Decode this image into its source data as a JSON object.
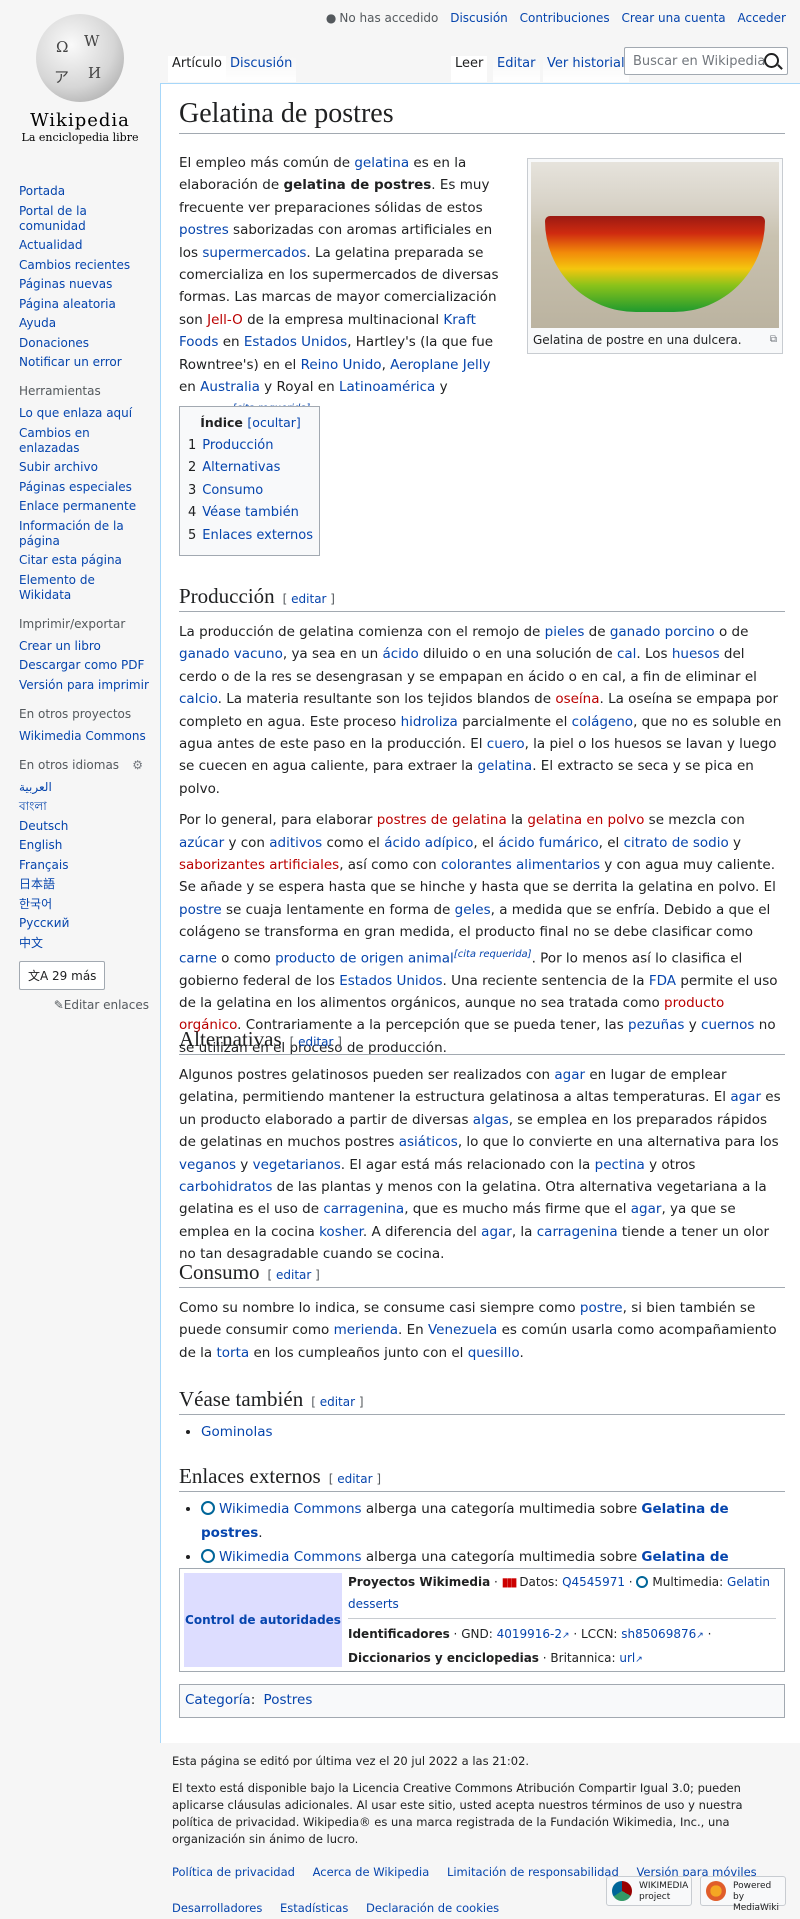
{
  "logo": {
    "wordmark": "Wikipedia",
    "tagline": "La enciclopedia libre"
  },
  "nav": [
    "Portada",
    "Portal de la comunidad",
    "Actualidad",
    "Cambios recientes",
    "Páginas nuevas",
    "Página aleatoria",
    "Ayuda",
    "Donaciones",
    "Notificar un error"
  ],
  "tools": {
    "heading": "Herramientas",
    "items": [
      "Lo que enlaza aquí",
      "Cambios en enlazadas",
      "Subir archivo",
      "Páginas especiales",
      "Enlace permanente",
      "Información de la página",
      "Citar esta página",
      "Elemento de Wikidata"
    ]
  },
  "print": {
    "heading": "Imprimir/exportar",
    "items": [
      "Crear un libro",
      "Descargar como PDF",
      "Versión para imprimir"
    ]
  },
  "projects": {
    "heading": "En otros proyectos",
    "items": [
      "Wikimedia Commons"
    ]
  },
  "langs": {
    "heading": "En otros idiomas",
    "items": [
      "العربية",
      "বাংলা",
      "Deutsch",
      "English",
      "Français",
      "日本語",
      "한국어",
      "Русский",
      "中文"
    ],
    "more": "29 más",
    "edit": "Editar enlaces"
  },
  "personal": {
    "not_logged": "No has accedido",
    "talk": "Discusión",
    "contribs": "Contribuciones",
    "create": "Crear una cuenta",
    "login": "Acceder"
  },
  "tabs": {
    "article": "Artículo",
    "talk": "Discusión",
    "read": "Leer",
    "edit": "Editar",
    "history": "Ver historial"
  },
  "search": {
    "placeholder": "Buscar en Wikipedia"
  },
  "title": "Gelatina de postres",
  "thumb_caption": "Gelatina de postre en una dulcera.",
  "toc": {
    "title": "Índice",
    "toggle": "[ocultar]",
    "items": [
      [
        "1",
        "Producción"
      ],
      [
        "2",
        "Alternativas"
      ],
      [
        "3",
        "Consumo"
      ],
      [
        "4",
        "Véase también"
      ],
      [
        "5",
        "Enlaces externos"
      ]
    ]
  },
  "sections": {
    "prod": "Producción",
    "alt": "Alternativas",
    "cons": "Consumo",
    "see": "Véase también",
    "ext": "Enlaces externos",
    "edit": "editar"
  },
  "see_also": [
    "Gominolas"
  ],
  "ext_links": [
    {
      "a": "Wikimedia Commons",
      "b": " alberga una categoría multimedia sobre ",
      "c": "Gelatina de postres",
      "d": "."
    },
    {
      "a": "Wikimedia Commons",
      "b": " alberga una categoría multimedia sobre ",
      "c": "Gelatina de postres",
      "d": "."
    }
  ],
  "authority": {
    "label": "Control de autoridades",
    "projects": "Proyectos Wikimedia",
    "data_label": "Datos:",
    "data_value": "Q4545971",
    "media_label": "Multimedia:",
    "media_value": "Gelatin desserts",
    "ids": "Identificadores",
    "gnd_label": "GND:",
    "gnd": "4019916-2",
    "lccn_label": "LCCN:",
    "lccn": "sh85069876",
    "dict": "Diccionarios y enciclopedias",
    "brit_label": "Britannica:",
    "brit": "url"
  },
  "category": {
    "label": "Categoría",
    "value": "Postres"
  },
  "footer": {
    "edited": "Esta página se editó por última vez el 20 jul 2022 a las 21:02.",
    "license": "El texto está disponible bajo la Licencia Creative Commons Atribución Compartir Igual 3.0; pueden aplicarse cláusulas adicionales. Al usar este sitio, usted acepta nuestros términos de uso y nuestra política de privacidad. Wikipedia® es una marca registrada de la Fundación Wikimedia, Inc., una organización sin ánimo de lucro.",
    "links1": [
      "Política de privacidad",
      "Acerca de Wikipedia",
      "Limitación de responsabilidad",
      "Versión para móviles"
    ],
    "links2": [
      "Desarrolladores",
      "Estadísticas",
      "Declaración de cookies"
    ],
    "badge1": "WIKIMEDIA project",
    "badge2": "Powered by MediaWiki"
  }
}
